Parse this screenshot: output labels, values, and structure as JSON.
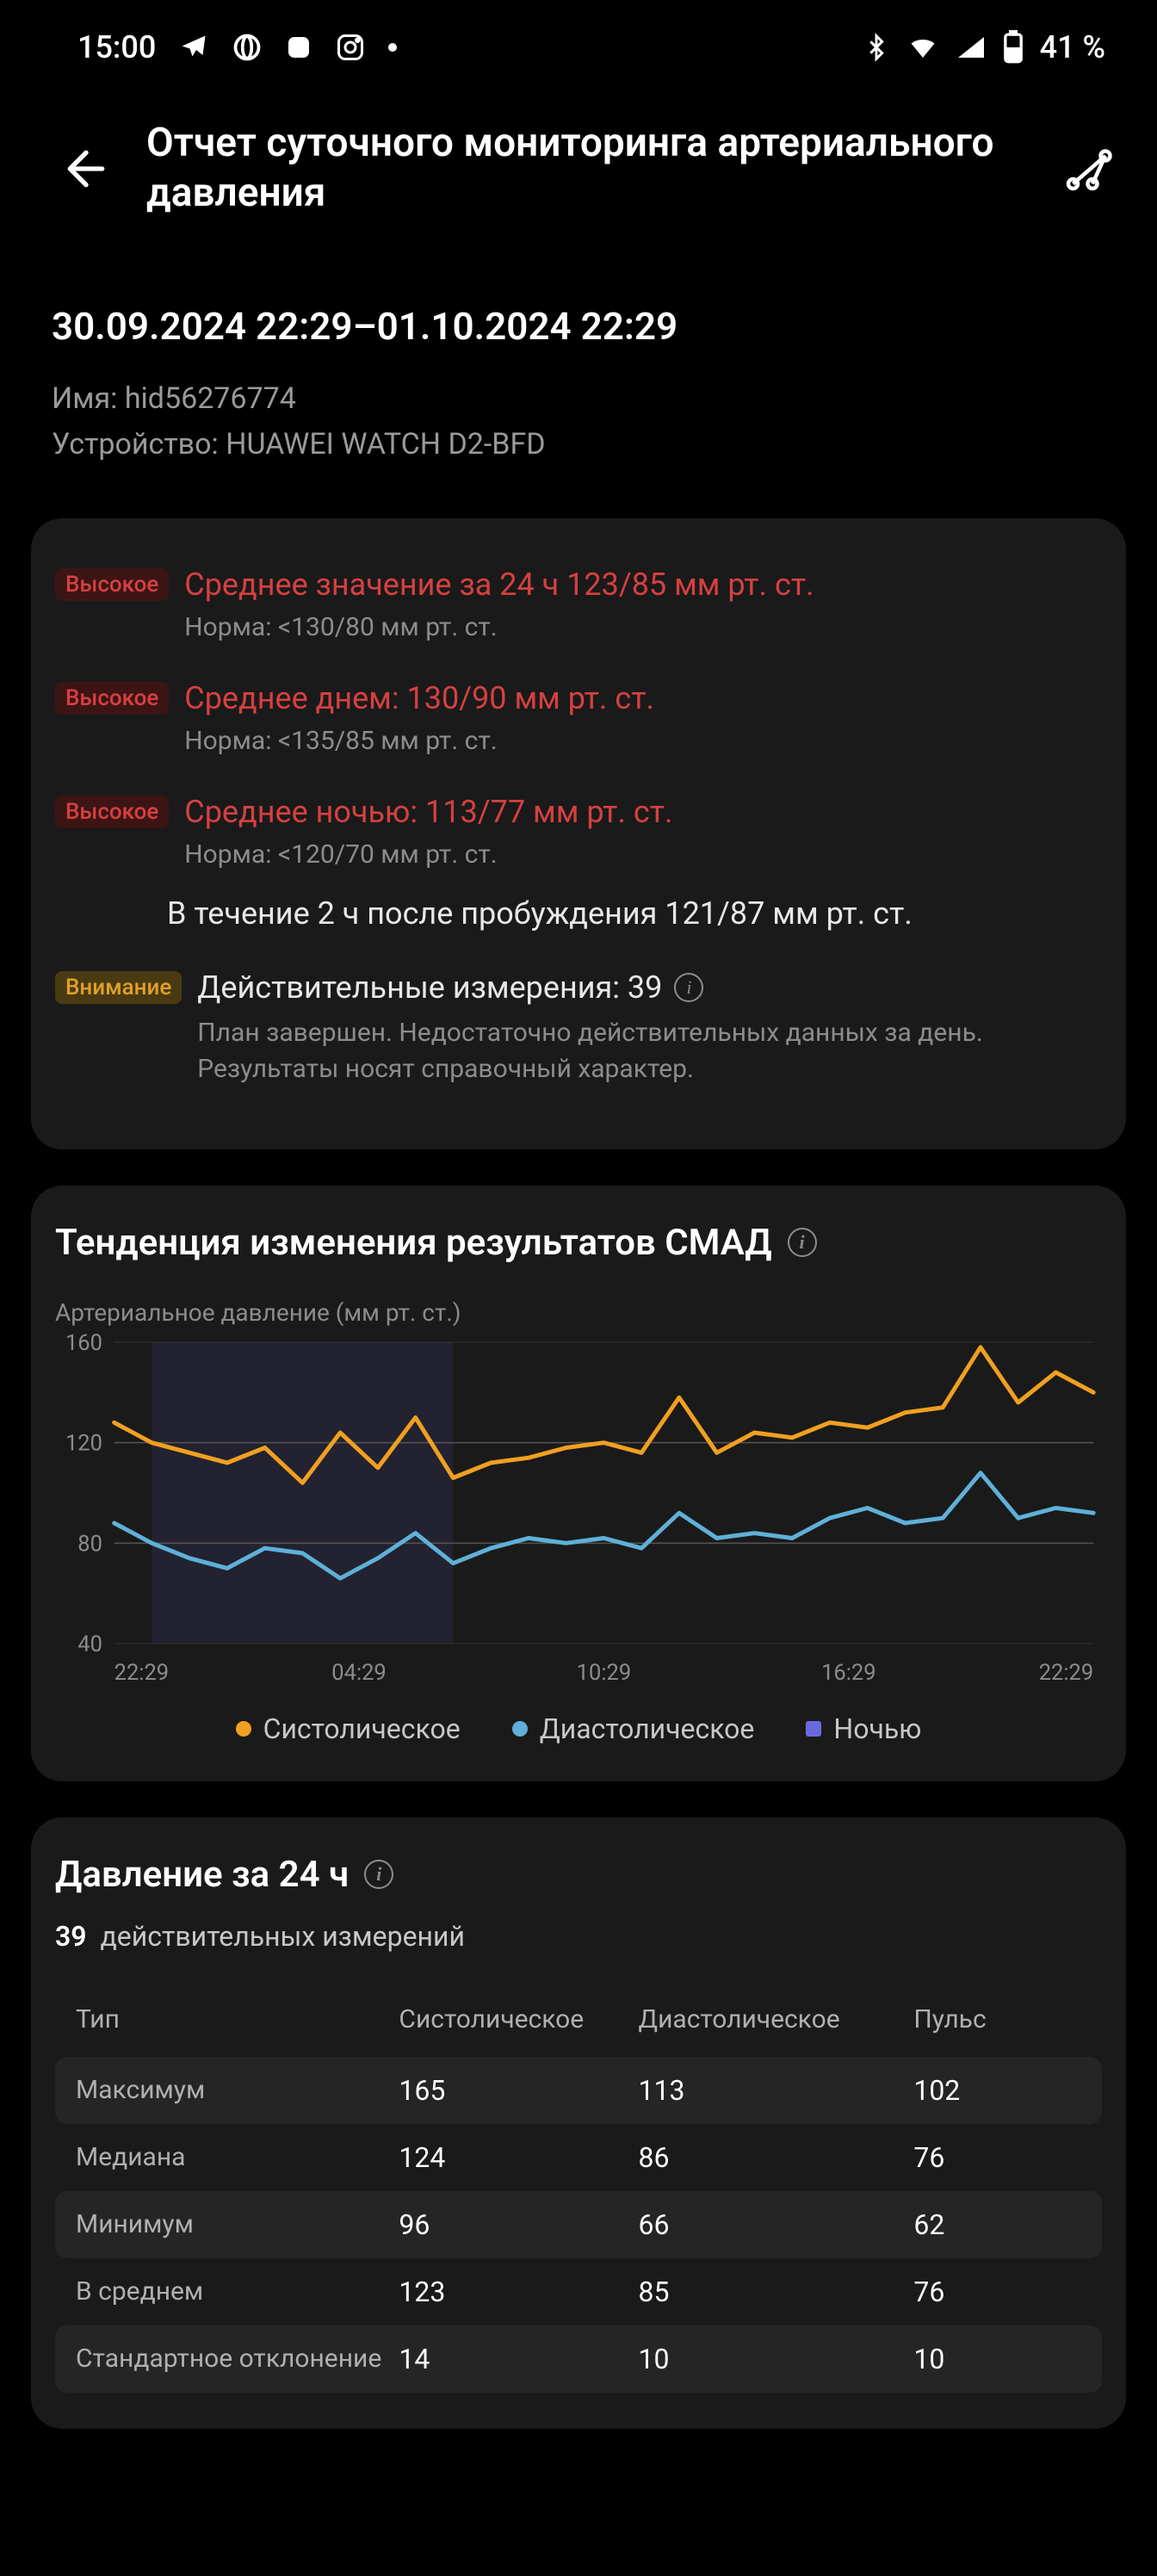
{
  "status": {
    "time": "15:00",
    "battery": "41 %"
  },
  "header": {
    "title": "Отчет суточного мониторинга артериального давления"
  },
  "meta": {
    "period": "30.09.2024 22:29–01.10.2024 22:29",
    "name_label": "Имя: ",
    "name": "hid56276774",
    "device_label": "Устройство: ",
    "device": "HUAWEI WATCH D2-BFD"
  },
  "summary": {
    "badge_high": "Высокое",
    "badge_warn": "Внимание",
    "avg24": "Среднее значение за 24 ч 123/85 мм рт. ст.",
    "avg24_norm": "Норма: <130/80 мм рт. ст.",
    "day": "Среднее днем: 130/90 мм рт. ст.",
    "day_norm": "Норма: <135/85 мм рт. ст.",
    "night": "Среднее ночью: 113/77 мм рт. ст.",
    "night_norm": "Норма: <120/70 мм рт. ст.",
    "wake": "В течение 2 ч после пробуждения 121/87 мм рт. ст.",
    "valid_title": "Действительные измерения: 39",
    "valid_note": "План завершен. Недостаточно действительных данных за день. Результаты носят справочный характер."
  },
  "trend": {
    "title": "Тенденция изменения результатов СМАД",
    "ylabel": "Артериальное давление (мм рт. ст.)",
    "legend_sys": "Систолическое",
    "legend_dia": "Диастолическое",
    "legend_night": "Ночью"
  },
  "chart_data": {
    "type": "line",
    "xlabel": "",
    "ylabel": "Артериальное давление (мм рт. ст.)",
    "ylim": [
      40,
      160
    ],
    "yticks": [
      40,
      80,
      120,
      160
    ],
    "xticks": [
      "22:29",
      "04:29",
      "10:29",
      "16:29",
      "22:29"
    ],
    "night_band_x": [
      1,
      9
    ],
    "series": [
      {
        "name": "Систолическое",
        "color": "#f0a020",
        "values": [
          128,
          120,
          116,
          112,
          118,
          104,
          124,
          110,
          130,
          106,
          112,
          114,
          118,
          120,
          116,
          138,
          116,
          124,
          122,
          128,
          126,
          132,
          134,
          158,
          136,
          148,
          140
        ]
      },
      {
        "name": "Диастолическое",
        "color": "#5fb0d8",
        "values": [
          88,
          80,
          74,
          70,
          78,
          76,
          66,
          74,
          84,
          72,
          78,
          82,
          80,
          82,
          78,
          92,
          82,
          84,
          82,
          90,
          94,
          88,
          90,
          108,
          90,
          94,
          92
        ]
      }
    ],
    "reference_lines": [
      120,
      80
    ]
  },
  "table24": {
    "title": "Давление за 24 ч",
    "count": "39",
    "count_label": "действительных измерений",
    "headers": [
      "Тип",
      "Систолическое",
      "Диастолическое",
      "Пульс"
    ],
    "rows": [
      {
        "label": "Максимум",
        "sys": "165",
        "dia": "113",
        "pulse": "102"
      },
      {
        "label": "Медиана",
        "sys": "124",
        "dia": "86",
        "pulse": "76"
      },
      {
        "label": "Минимум",
        "sys": "96",
        "dia": "66",
        "pulse": "62"
      },
      {
        "label": "В среднем",
        "sys": "123",
        "dia": "85",
        "pulse": "76"
      },
      {
        "label": "Стандартное отклонение",
        "sys": "14",
        "dia": "10",
        "pulse": "10"
      }
    ]
  }
}
